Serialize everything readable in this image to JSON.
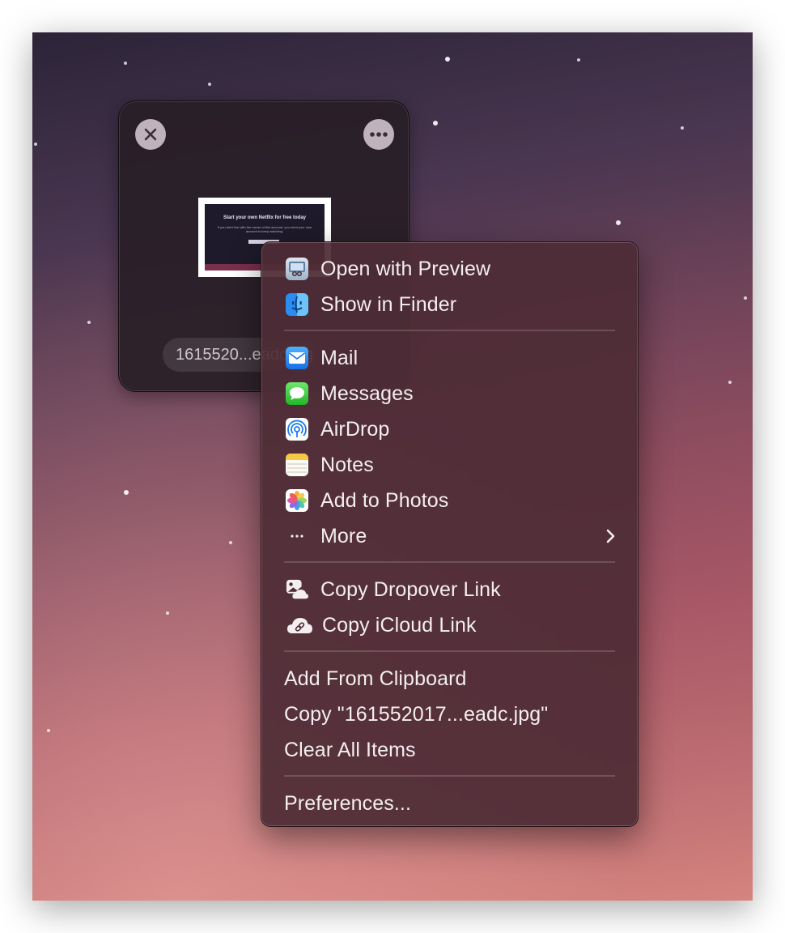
{
  "shelf": {
    "file_name": "1615520...eadc.jpg",
    "thumbnail": {
      "title": "Start your own Netflix for free today",
      "subtitle": "If you don't live with the owner of this account, you need your own account to keep watching."
    }
  },
  "menu": {
    "open_with_preview": "Open with Preview",
    "show_in_finder": "Show in Finder",
    "mail": "Mail",
    "messages": "Messages",
    "airdrop": "AirDrop",
    "notes": "Notes",
    "add_to_photos": "Add to Photos",
    "more": "More",
    "copy_dropover_link": "Copy Dropover Link",
    "copy_icloud_link": "Copy iCloud Link",
    "add_from_clipboard": "Add From Clipboard",
    "copy_file": "Copy \"161552017...eadc.jpg\"",
    "clear_all_items": "Clear All Items",
    "preferences": "Preferences..."
  },
  "icons": {
    "preview": "preview-app-icon",
    "finder": "finder-app-icon",
    "mail": "mail-app-icon",
    "messages": "messages-app-icon",
    "airdrop": "airdrop-icon",
    "notes": "notes-app-icon",
    "photos": "photos-app-icon",
    "more": "ellipsis-icon",
    "dropover": "dropover-link-icon",
    "icloud": "icloud-link-icon"
  },
  "colors": {
    "menu_background": "#4e2c36",
    "menu_text": "#f4eef0",
    "shelf_background": "#281e26"
  }
}
